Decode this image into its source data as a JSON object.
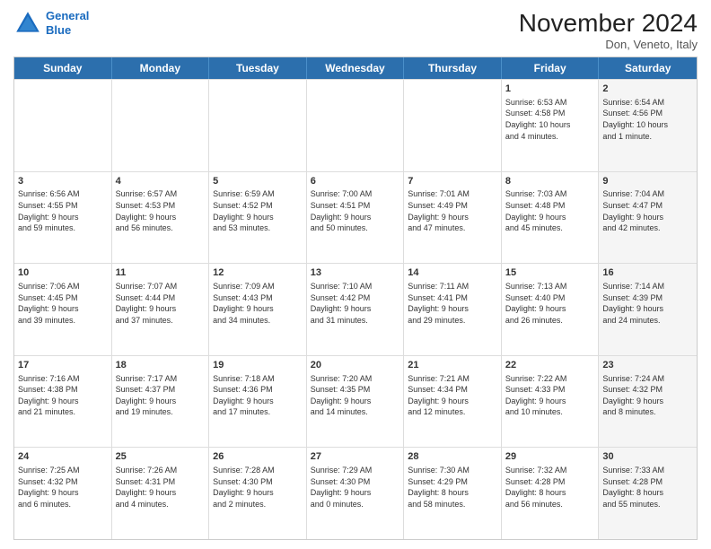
{
  "logo": {
    "line1": "General",
    "line2": "Blue"
  },
  "title": "November 2024",
  "location": "Don, Veneto, Italy",
  "header_days": [
    "Sunday",
    "Monday",
    "Tuesday",
    "Wednesday",
    "Thursday",
    "Friday",
    "Saturday"
  ],
  "rows": [
    [
      {
        "day": "",
        "info": "",
        "shaded": false,
        "empty": true
      },
      {
        "day": "",
        "info": "",
        "shaded": false,
        "empty": true
      },
      {
        "day": "",
        "info": "",
        "shaded": false,
        "empty": true
      },
      {
        "day": "",
        "info": "",
        "shaded": false,
        "empty": true
      },
      {
        "day": "",
        "info": "",
        "shaded": false,
        "empty": true
      },
      {
        "day": "1",
        "info": "Sunrise: 6:53 AM\nSunset: 4:58 PM\nDaylight: 10 hours\nand 4 minutes.",
        "shaded": false
      },
      {
        "day": "2",
        "info": "Sunrise: 6:54 AM\nSunset: 4:56 PM\nDaylight: 10 hours\nand 1 minute.",
        "shaded": true
      }
    ],
    [
      {
        "day": "3",
        "info": "Sunrise: 6:56 AM\nSunset: 4:55 PM\nDaylight: 9 hours\nand 59 minutes.",
        "shaded": false
      },
      {
        "day": "4",
        "info": "Sunrise: 6:57 AM\nSunset: 4:53 PM\nDaylight: 9 hours\nand 56 minutes.",
        "shaded": false
      },
      {
        "day": "5",
        "info": "Sunrise: 6:59 AM\nSunset: 4:52 PM\nDaylight: 9 hours\nand 53 minutes.",
        "shaded": false
      },
      {
        "day": "6",
        "info": "Sunrise: 7:00 AM\nSunset: 4:51 PM\nDaylight: 9 hours\nand 50 minutes.",
        "shaded": false
      },
      {
        "day": "7",
        "info": "Sunrise: 7:01 AM\nSunset: 4:49 PM\nDaylight: 9 hours\nand 47 minutes.",
        "shaded": false
      },
      {
        "day": "8",
        "info": "Sunrise: 7:03 AM\nSunset: 4:48 PM\nDaylight: 9 hours\nand 45 minutes.",
        "shaded": false
      },
      {
        "day": "9",
        "info": "Sunrise: 7:04 AM\nSunset: 4:47 PM\nDaylight: 9 hours\nand 42 minutes.",
        "shaded": true
      }
    ],
    [
      {
        "day": "10",
        "info": "Sunrise: 7:06 AM\nSunset: 4:45 PM\nDaylight: 9 hours\nand 39 minutes.",
        "shaded": false
      },
      {
        "day": "11",
        "info": "Sunrise: 7:07 AM\nSunset: 4:44 PM\nDaylight: 9 hours\nand 37 minutes.",
        "shaded": false
      },
      {
        "day": "12",
        "info": "Sunrise: 7:09 AM\nSunset: 4:43 PM\nDaylight: 9 hours\nand 34 minutes.",
        "shaded": false
      },
      {
        "day": "13",
        "info": "Sunrise: 7:10 AM\nSunset: 4:42 PM\nDaylight: 9 hours\nand 31 minutes.",
        "shaded": false
      },
      {
        "day": "14",
        "info": "Sunrise: 7:11 AM\nSunset: 4:41 PM\nDaylight: 9 hours\nand 29 minutes.",
        "shaded": false
      },
      {
        "day": "15",
        "info": "Sunrise: 7:13 AM\nSunset: 4:40 PM\nDaylight: 9 hours\nand 26 minutes.",
        "shaded": false
      },
      {
        "day": "16",
        "info": "Sunrise: 7:14 AM\nSunset: 4:39 PM\nDaylight: 9 hours\nand 24 minutes.",
        "shaded": true
      }
    ],
    [
      {
        "day": "17",
        "info": "Sunrise: 7:16 AM\nSunset: 4:38 PM\nDaylight: 9 hours\nand 21 minutes.",
        "shaded": false
      },
      {
        "day": "18",
        "info": "Sunrise: 7:17 AM\nSunset: 4:37 PM\nDaylight: 9 hours\nand 19 minutes.",
        "shaded": false
      },
      {
        "day": "19",
        "info": "Sunrise: 7:18 AM\nSunset: 4:36 PM\nDaylight: 9 hours\nand 17 minutes.",
        "shaded": false
      },
      {
        "day": "20",
        "info": "Sunrise: 7:20 AM\nSunset: 4:35 PM\nDaylight: 9 hours\nand 14 minutes.",
        "shaded": false
      },
      {
        "day": "21",
        "info": "Sunrise: 7:21 AM\nSunset: 4:34 PM\nDaylight: 9 hours\nand 12 minutes.",
        "shaded": false
      },
      {
        "day": "22",
        "info": "Sunrise: 7:22 AM\nSunset: 4:33 PM\nDaylight: 9 hours\nand 10 minutes.",
        "shaded": false
      },
      {
        "day": "23",
        "info": "Sunrise: 7:24 AM\nSunset: 4:32 PM\nDaylight: 9 hours\nand 8 minutes.",
        "shaded": true
      }
    ],
    [
      {
        "day": "24",
        "info": "Sunrise: 7:25 AM\nSunset: 4:32 PM\nDaylight: 9 hours\nand 6 minutes.",
        "shaded": false
      },
      {
        "day": "25",
        "info": "Sunrise: 7:26 AM\nSunset: 4:31 PM\nDaylight: 9 hours\nand 4 minutes.",
        "shaded": false
      },
      {
        "day": "26",
        "info": "Sunrise: 7:28 AM\nSunset: 4:30 PM\nDaylight: 9 hours\nand 2 minutes.",
        "shaded": false
      },
      {
        "day": "27",
        "info": "Sunrise: 7:29 AM\nSunset: 4:30 PM\nDaylight: 9 hours\nand 0 minutes.",
        "shaded": false
      },
      {
        "day": "28",
        "info": "Sunrise: 7:30 AM\nSunset: 4:29 PM\nDaylight: 8 hours\nand 58 minutes.",
        "shaded": false
      },
      {
        "day": "29",
        "info": "Sunrise: 7:32 AM\nSunset: 4:28 PM\nDaylight: 8 hours\nand 56 minutes.",
        "shaded": false
      },
      {
        "day": "30",
        "info": "Sunrise: 7:33 AM\nSunset: 4:28 PM\nDaylight: 8 hours\nand 55 minutes.",
        "shaded": true
      }
    ]
  ]
}
